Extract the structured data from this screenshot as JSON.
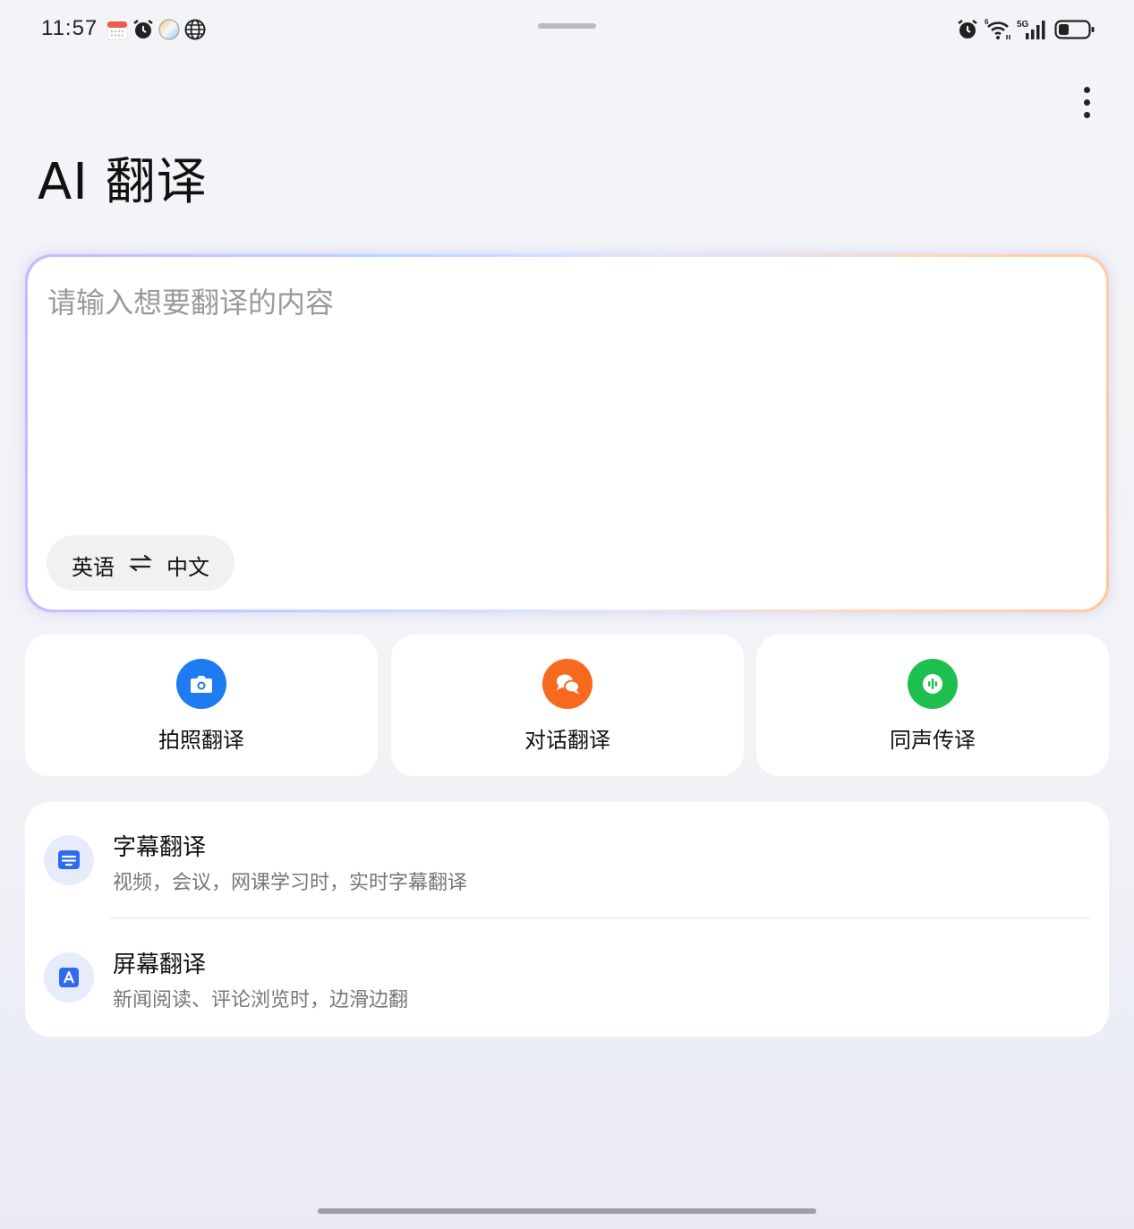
{
  "status_bar": {
    "time": "11:57",
    "left_icons": [
      "calendar-icon",
      "alarm-icon",
      "app-circle-icon",
      "globe-icon"
    ],
    "right_icons": [
      "alarm-icon",
      "wifi-6-icon",
      "signal-5g-icon",
      "battery-icon"
    ]
  },
  "header": {
    "title": "AI 翻译",
    "more_icon": "more-vertical-icon"
  },
  "input": {
    "placeholder": "请输入想要翻译的内容",
    "source_lang": "英语",
    "target_lang": "中文",
    "swap_icon": "swap-icon"
  },
  "features": [
    {
      "label": "拍照翻译",
      "icon": "camera-icon",
      "color": "#1f7cf0"
    },
    {
      "label": "对话翻译",
      "icon": "chat-bubbles-icon",
      "color": "#f76a1d"
    },
    {
      "label": "同声传译",
      "icon": "audio-wave-icon",
      "color": "#1fbf4f"
    }
  ],
  "list": [
    {
      "title": "字幕翻译",
      "desc": "视频，会议，网课学习时，实时字幕翻译",
      "icon": "subtitle-icon"
    },
    {
      "title": "屏幕翻译",
      "desc": "新闻阅读、评论浏览时，边滑边翻",
      "icon": "screen-translate-icon"
    }
  ],
  "colors": {
    "accent_blue": "#2f6bf0",
    "card_bg": "#ffffff",
    "page_bg": "#f3f4f7"
  }
}
